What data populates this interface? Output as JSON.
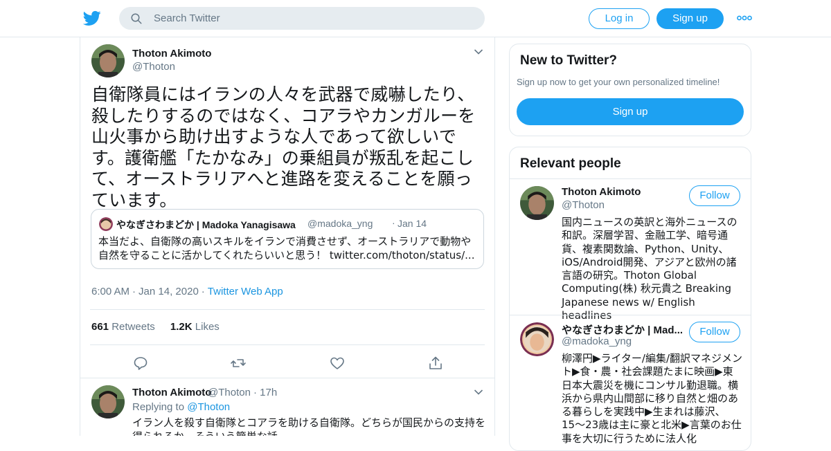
{
  "header": {
    "search_placeholder": "Search Twitter",
    "login_label": "Log in",
    "signup_label": "Sign up",
    "brand_color": "#1da1f2"
  },
  "tweet": {
    "author_name": "Thoton Akimoto",
    "author_handle": "@Thoton",
    "text": "自衛隊員にはイランの人々を武器で威嚇したり、殺したりするのではなく、コアラやカンガルーを山火事から助け出すような人であって欲しいです。護衛艦「たかなみ」の乗組員が叛乱を起こして、オーストラリアへと進路を変えることを願っています。",
    "quote": {
      "name": "やなぎさわまどか | Madoka Yanagisawa",
      "handle": "@madoka_yng",
      "dot": "·",
      "time": "Jan 14",
      "text": "本当だよ、自衛隊の高いスキルをイランで消費させず、オーストラリアで動物や自然を守ることに活かしてくれたらいいと思う！ twitter.com/thoton/status/..."
    },
    "time": "6:00 AM",
    "date": "Jan 14, 2020",
    "source": "Twitter Web App",
    "separator": "·",
    "retweets_count": "661",
    "retweets_label": "Retweets",
    "likes_count": "1.2K",
    "likes_label": "Likes",
    "actions": [
      "reply-icon",
      "retweet-icon",
      "like-icon",
      "share-icon"
    ]
  },
  "reply": {
    "author_name": "Thoton Akimoto",
    "author_handle": "@Thoton",
    "time": "· 17h",
    "replying_to_label": "Replying to",
    "replying_to_handle": "@Thoton",
    "text": "イラン人を殺す自衛隊とコアラを助ける自衛隊。どちらが国民からの支持を得られるか。そういう簡単な話。"
  },
  "sidebar": {
    "new_to_twitter": {
      "title": "New to Twitter?",
      "subtitle": "Sign up now to get your own personalized timeline!",
      "button": "Sign up"
    },
    "relevant": {
      "title": "Relevant people",
      "people": [
        {
          "name": "Thoton Akimoto",
          "handle": "@Thoton",
          "follow": "Follow",
          "bio": "国内ニュースの英訳と海外ニュースの和訳。深層学習、金融工学、暗号通貨、複素関数論、Python、Unity、iOS/Android開発、アジアと欧州の諸言語の研究。Thoton Global Computing(株) 秋元貴之 Breaking Japanese news w/ English headlines"
        },
        {
          "name": "やなぎさわまどか | Mad...",
          "handle": "@madoka_yng",
          "follow": "Follow",
          "bio": "柳澤円▶ライター/編集/翻訳マネジメント▶食・農・社会課題たまに映画▶東日本大震災を機にコンサル勤退職。横浜から県内山間部に移り自然と畑のある暮らしを実践中▶生まれは藤沢、15〜23歳は主に豪と北米▶言葉のお仕事を大切に行うために法人化"
        }
      ]
    }
  }
}
